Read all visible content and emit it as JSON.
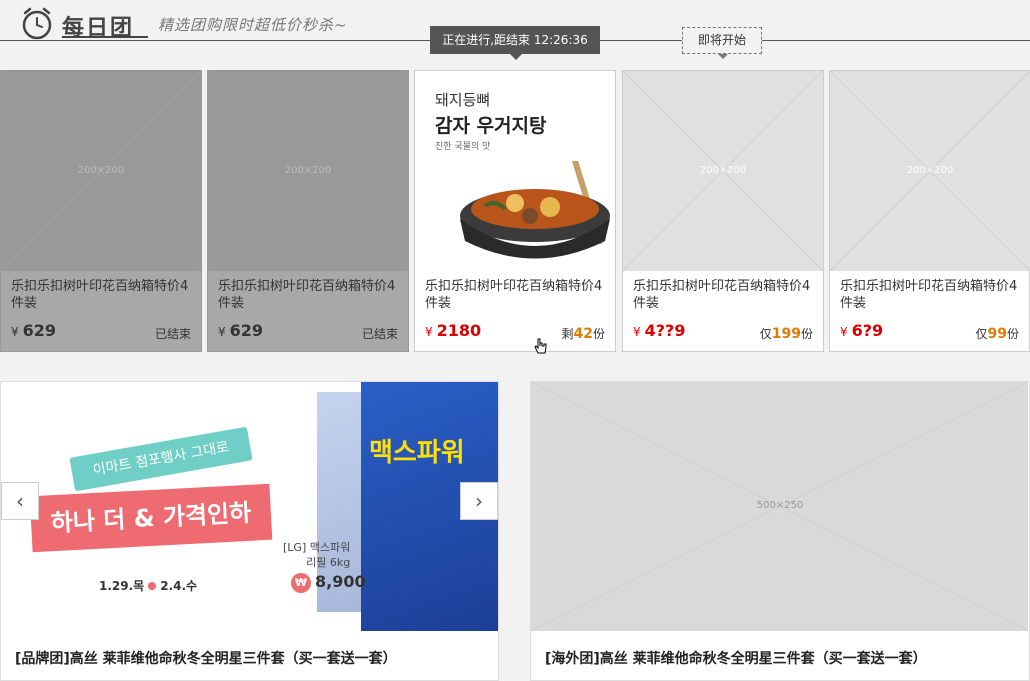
{
  "header": {
    "logo_text": "每日团",
    "slogan": "精选团购限时超低价秒杀~",
    "active_tip": "正在进行,距结束 12:26:36",
    "soon_tip": "即将开始"
  },
  "products": [
    {
      "title": "乐扣乐扣树叶印花百纳箱特价4件装",
      "currency": "¥",
      "price": "629",
      "state": "已结束",
      "placeholder": "200×200"
    },
    {
      "title": "乐扣乐扣树叶印花百纳箱特价4件装",
      "currency": "¥",
      "price": "629",
      "state": "已结束",
      "placeholder": "200×200"
    },
    {
      "title": "乐扣乐扣树叶印花百纳箱特价4件装",
      "currency": "¥",
      "price": "2180",
      "state_prefix": "剩",
      "state_num": "42",
      "state_suffix": "份",
      "food_line1": "돼지등뼈",
      "food_line2": "감자 우거지탕",
      "food_line3": "진한 국물의 맛"
    },
    {
      "title": "乐扣乐扣树叶印花百纳箱特价4件装",
      "currency": "¥",
      "price": "4??9",
      "state_prefix": "仅",
      "state_num": "199",
      "state_suffix": "份",
      "placeholder": "200×200"
    },
    {
      "title": "乐扣乐扣树叶印花百纳箱特价4件装",
      "currency": "¥",
      "price": "6?9",
      "state_prefix": "仅",
      "state_num": "99",
      "state_suffix": "份",
      "placeholder": "200×200"
    }
  ],
  "banners": [
    {
      "title": "[品牌团]高丝 莱菲维他命秋冬全明星三件套（买一套送一套）",
      "ribbon1": "이마트 점포행사 그대로",
      "ribbon2": "하나 더 & 가격인하",
      "date1": "1.29.목",
      "date2": "2.4.수",
      "product_line1": "[LG] 맥스파워",
      "product_line2": "리필 6kg",
      "won": "₩",
      "price": "8,900",
      "bag_label": "맥스파워",
      "prev": "‹",
      "next": "›"
    },
    {
      "title": "[海外团]高丝 莱菲维他命秋冬全明星三件套（买一套送一套）",
      "placeholder": "500×250"
    }
  ]
}
